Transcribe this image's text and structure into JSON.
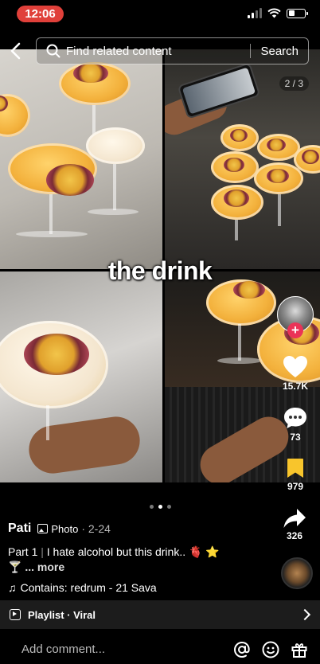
{
  "status_bar": {
    "time": "12:06",
    "accent": "#e0403a"
  },
  "search": {
    "placeholder": "Find related content",
    "button": "Search"
  },
  "media": {
    "page_indicator": "2 / 3",
    "caption_overlay": "the drink",
    "slide_count": 3,
    "active_slide": 2
  },
  "actions": {
    "likes": "15.7K",
    "comments": "73",
    "saves": "979",
    "shares": "326",
    "follow_icon": "plus-icon",
    "like_icon": "heart-icon",
    "comment_icon": "comment-bubble-icon",
    "save_icon": "bookmark-icon",
    "share_icon": "share-arrow-icon",
    "save_color": "#f8c52c",
    "follow_color": "#ea3357"
  },
  "post": {
    "author": "Pati",
    "media_type": "Photo",
    "date": "· 2-24",
    "description_part": "Part 1",
    "description_sep": "|",
    "description_text": "I hate alcohol but this drink.. 🫀 ⭐",
    "description_line2": "🍸",
    "more": "... more",
    "music": "Contains: redrum - 21 Sava"
  },
  "playlist": {
    "label": "Playlist · Viral"
  },
  "comment": {
    "placeholder": "Add comment..."
  }
}
